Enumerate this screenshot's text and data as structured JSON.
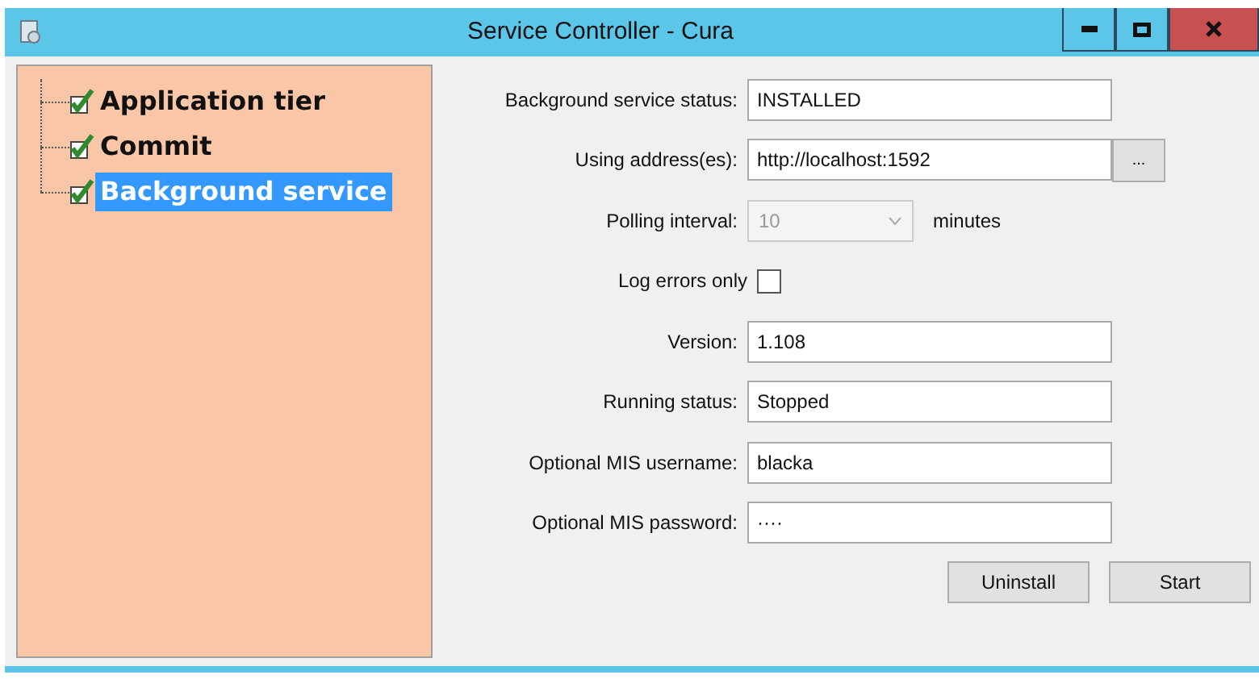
{
  "window": {
    "title": "Service Controller - Cura"
  },
  "tree": {
    "items": [
      {
        "label": "Application tier",
        "checked": true,
        "selected": false
      },
      {
        "label": "Commit",
        "checked": true,
        "selected": false
      },
      {
        "label": "Background service",
        "checked": true,
        "selected": true
      }
    ]
  },
  "form": {
    "rows": [
      {
        "kind": "text",
        "label": "Background service status:",
        "value": "INSTALLED"
      },
      {
        "kind": "text_button",
        "label": "Using address(es):",
        "value": "http://localhost:1592",
        "button": "..."
      },
      {
        "kind": "select",
        "label": "Polling interval:",
        "value": "10",
        "disabled": true,
        "suffix": "minutes"
      },
      {
        "kind": "checkbox",
        "label": "Log errors only",
        "checked": false
      },
      {
        "kind": "text",
        "label": "Version:",
        "value": "1.108"
      },
      {
        "kind": "text",
        "label": "Running status:",
        "value": "Stopped"
      },
      {
        "kind": "text",
        "label": "Optional MIS username:",
        "value": "blacka"
      },
      {
        "kind": "text",
        "label": "Optional MIS password:",
        "value": "····"
      }
    ]
  },
  "buttons": [
    "Uninstall",
    "Start"
  ]
}
